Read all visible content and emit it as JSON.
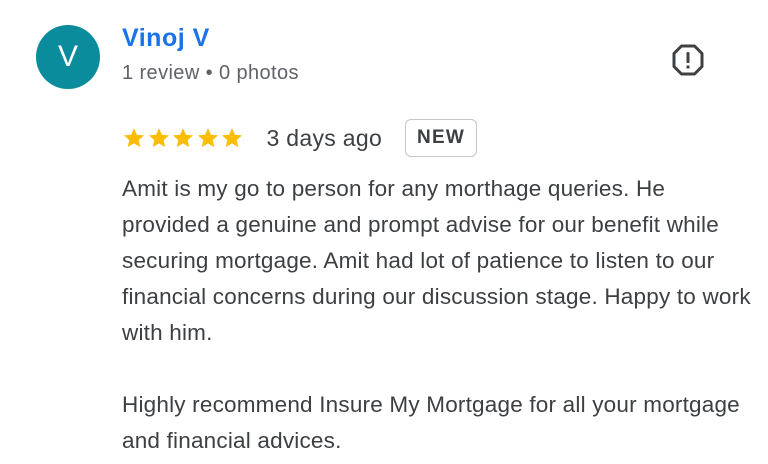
{
  "author": {
    "initial": "V",
    "avatar_color": "#0b8c9c",
    "name": "Vinoj V",
    "meta": "1 review • 0 photos"
  },
  "report": {
    "icon": "report-flag-icon"
  },
  "rating": {
    "stars": 5,
    "max_stars": 5,
    "star_color": "#fbbc04",
    "date": "3 days ago",
    "badge": "NEW"
  },
  "review": {
    "paragraph_1": "Amit is my go to person for any morthage queries. He provided a genuine and prompt advise for our benefit while securing mortgage. Amit had lot of patience to listen to our financial concerns during our discussion stage. Happy to work with him.",
    "paragraph_2": "Highly recommend Insure My Mortgage for all your mortgage and financial advices."
  }
}
